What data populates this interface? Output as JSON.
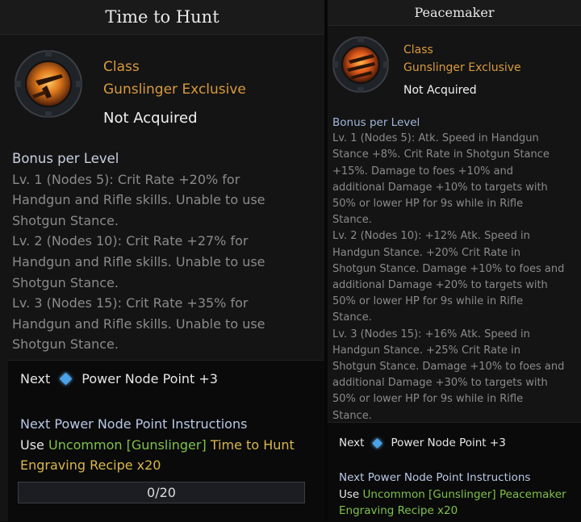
{
  "left": {
    "title": "Time to Hunt",
    "class_label": "Class",
    "class_value": "Gunslinger Exclusive",
    "status": "Not Acquired",
    "bonus_header": "Bonus per Level",
    "bonus_lines": [
      "Lv. 1 (Nodes 5): Crit Rate +20% for",
      "Handgun and Rifle skills. Unable to use",
      "Shotgun Stance.",
      "Lv. 2 (Nodes 10): Crit Rate +27% for",
      "Handgun and Rifle skills. Unable to use",
      "Shotgun Stance.",
      "Lv. 3 (Nodes 15): Crit Rate +35% for",
      "Handgun and Rifle skills. Unable to use",
      "Shotgun Stance."
    ],
    "next_label": "Next",
    "next_value": "Power Node Point +3",
    "instr_header": "Next Power Node Point Instructions",
    "use_label": "Use",
    "use_item": "Uncommon [Gunslinger]",
    "use_item_name": "Time to Hunt",
    "use_item_rest": "Engraving Recipe x20",
    "progress_text": "0/20",
    "progress_value": 0
  },
  "right": {
    "title": "Peacemaker",
    "class_label": "Class",
    "class_value": "Gunslinger Exclusive",
    "status": "Not Acquired",
    "bonus_header": "Bonus per Level",
    "bonus_lines": [
      "Lv. 1 (Nodes 5): Atk. Speed in Handgun",
      "Stance +8%. Crit Rate in Shotgun Stance",
      "+15%. Damage to foes +10% and",
      "additional Damage +10% to targets with",
      "50% or lower HP for 9s while in Rifle",
      "Stance.",
      "Lv. 2 (Nodes 10): +12% Atk. Speed in",
      "Handgun Stance. +20% Crit Rate in",
      "Shotgun Stance. Damage +10% to foes and",
      "additional Damage +20% to targets with",
      "50% or lower HP for 9s while in Rifle",
      "Stance.",
      "Lv. 3 (Nodes 15): +16% Atk. Speed in",
      "Handgun Stance. +25% Crit Rate in",
      "Shotgun Stance. Damage +10% to foes and",
      "additional Damage +30% to targets with",
      "50% or lower HP for 9s while in Rifle",
      "Stance."
    ],
    "next_label": "Next",
    "next_value": "Power Node Point +3",
    "instr_header": "Next Power Node Point Instructions",
    "use_label": "Use",
    "use_item": "Uncommon [Gunslinger] Peacemaker",
    "use_item_rest": "Engraving Recipe x20"
  },
  "icons": {
    "left": "time-to-hunt-engraving-icon",
    "right": "peacemaker-engraving-icon",
    "node": "power-node-gem-icon"
  },
  "colors": {
    "class_orange": "#d89a3e",
    "uncommon_green": "#7fc24a",
    "gold_text": "#d9b74a",
    "gem_blue": "#4aa3e8"
  }
}
